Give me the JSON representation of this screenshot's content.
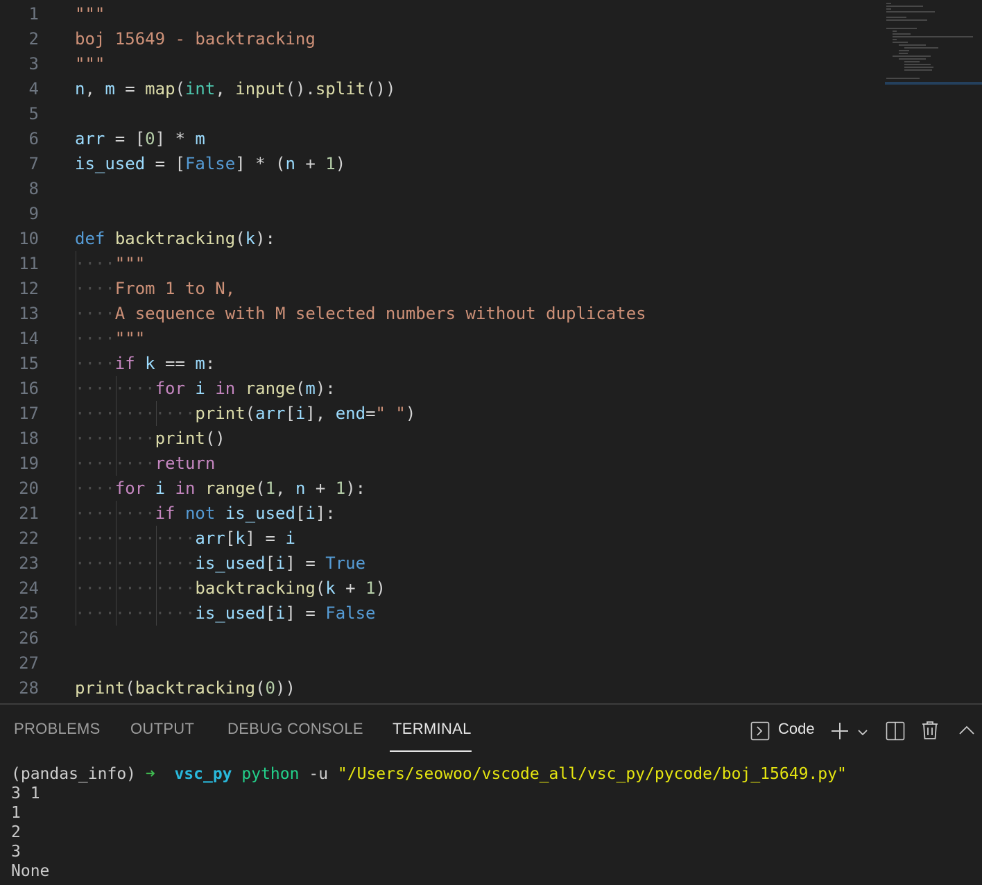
{
  "editor": {
    "lines": [
      {
        "n": "1",
        "tokens": [
          [
            "str",
            "\"\"\""
          ]
        ]
      },
      {
        "n": "2",
        "tokens": [
          [
            "str",
            "boj 15649 - backtracking"
          ]
        ]
      },
      {
        "n": "3",
        "tokens": [
          [
            "str",
            "\"\"\""
          ]
        ]
      },
      {
        "n": "4",
        "tokens": [
          [
            "var",
            "n"
          ],
          [
            "op",
            ", "
          ],
          [
            "var",
            "m"
          ],
          [
            "op",
            " = "
          ],
          [
            "fn",
            "map"
          ],
          [
            "op",
            "("
          ],
          [
            "type",
            "int"
          ],
          [
            "op",
            ", "
          ],
          [
            "fn",
            "input"
          ],
          [
            "op",
            "()."
          ],
          [
            "fn",
            "split"
          ],
          [
            "op",
            "())"
          ]
        ]
      },
      {
        "n": "5",
        "tokens": []
      },
      {
        "n": "6",
        "tokens": [
          [
            "var",
            "arr"
          ],
          [
            "op",
            " = ["
          ],
          [
            "num",
            "0"
          ],
          [
            "op",
            "] * "
          ],
          [
            "var",
            "m"
          ]
        ]
      },
      {
        "n": "7",
        "tokens": [
          [
            "var",
            "is_used"
          ],
          [
            "op",
            " = ["
          ],
          [
            "kw",
            "False"
          ],
          [
            "op",
            "] * ("
          ],
          [
            "var",
            "n"
          ],
          [
            "op",
            " + "
          ],
          [
            "num",
            "1"
          ],
          [
            "op",
            ")"
          ]
        ]
      },
      {
        "n": "8",
        "tokens": []
      },
      {
        "n": "9",
        "tokens": []
      },
      {
        "n": "10",
        "tokens": [
          [
            "kw",
            "def"
          ],
          [
            "op",
            " "
          ],
          [
            "fn",
            "backtracking"
          ],
          [
            "op",
            "("
          ],
          [
            "var",
            "k"
          ],
          [
            "op",
            "):"
          ]
        ]
      },
      {
        "n": "11",
        "tokens": [
          [
            "ws",
            "····"
          ],
          [
            "str",
            "\"\"\""
          ]
        ]
      },
      {
        "n": "12",
        "tokens": [
          [
            "ws",
            "····"
          ],
          [
            "str",
            "From 1 to N,"
          ]
        ]
      },
      {
        "n": "13",
        "tokens": [
          [
            "ws",
            "····"
          ],
          [
            "str",
            "A sequence with M selected numbers without duplicates"
          ]
        ]
      },
      {
        "n": "14",
        "tokens": [
          [
            "ws",
            "····"
          ],
          [
            "str",
            "\"\"\""
          ]
        ]
      },
      {
        "n": "15",
        "tokens": [
          [
            "ws",
            "····"
          ],
          [
            "ctl",
            "if"
          ],
          [
            "op",
            " "
          ],
          [
            "var",
            "k"
          ],
          [
            "op",
            " == "
          ],
          [
            "var",
            "m"
          ],
          [
            "op",
            ":"
          ]
        ]
      },
      {
        "n": "16",
        "tokens": [
          [
            "ws",
            "········"
          ],
          [
            "ctl",
            "for"
          ],
          [
            "op",
            " "
          ],
          [
            "var",
            "i"
          ],
          [
            "op",
            " "
          ],
          [
            "ctl",
            "in"
          ],
          [
            "op",
            " "
          ],
          [
            "fn",
            "range"
          ],
          [
            "op",
            "("
          ],
          [
            "var",
            "m"
          ],
          [
            "op",
            "):"
          ]
        ]
      },
      {
        "n": "17",
        "tokens": [
          [
            "ws",
            "············"
          ],
          [
            "fn",
            "print"
          ],
          [
            "op",
            "("
          ],
          [
            "var",
            "arr"
          ],
          [
            "op",
            "["
          ],
          [
            "var",
            "i"
          ],
          [
            "op",
            "], "
          ],
          [
            "var",
            "end"
          ],
          [
            "op",
            "="
          ],
          [
            "str",
            "\" \""
          ],
          [
            "op",
            ")"
          ]
        ]
      },
      {
        "n": "18",
        "tokens": [
          [
            "ws",
            "········"
          ],
          [
            "fn",
            "print"
          ],
          [
            "op",
            "()"
          ]
        ]
      },
      {
        "n": "19",
        "tokens": [
          [
            "ws",
            "········"
          ],
          [
            "ctl",
            "return"
          ]
        ]
      },
      {
        "n": "20",
        "tokens": [
          [
            "ws",
            "····"
          ],
          [
            "ctl",
            "for"
          ],
          [
            "op",
            " "
          ],
          [
            "var",
            "i"
          ],
          [
            "op",
            " "
          ],
          [
            "ctl",
            "in"
          ],
          [
            "op",
            " "
          ],
          [
            "fn",
            "range"
          ],
          [
            "op",
            "("
          ],
          [
            "num",
            "1"
          ],
          [
            "op",
            ", "
          ],
          [
            "var",
            "n"
          ],
          [
            "op",
            " + "
          ],
          [
            "num",
            "1"
          ],
          [
            "op",
            "):"
          ]
        ]
      },
      {
        "n": "21",
        "tokens": [
          [
            "ws",
            "········"
          ],
          [
            "ctl",
            "if"
          ],
          [
            "op",
            " "
          ],
          [
            "kw",
            "not"
          ],
          [
            "op",
            " "
          ],
          [
            "var",
            "is_used"
          ],
          [
            "op",
            "["
          ],
          [
            "var",
            "i"
          ],
          [
            "op",
            "]:"
          ]
        ]
      },
      {
        "n": "22",
        "tokens": [
          [
            "ws",
            "············"
          ],
          [
            "var",
            "arr"
          ],
          [
            "op",
            "["
          ],
          [
            "var",
            "k"
          ],
          [
            "op",
            "] = "
          ],
          [
            "var",
            "i"
          ]
        ]
      },
      {
        "n": "23",
        "tokens": [
          [
            "ws",
            "············"
          ],
          [
            "var",
            "is_used"
          ],
          [
            "op",
            "["
          ],
          [
            "var",
            "i"
          ],
          [
            "op",
            "] = "
          ],
          [
            "kw",
            "True"
          ]
        ]
      },
      {
        "n": "24",
        "tokens": [
          [
            "ws",
            "············"
          ],
          [
            "fn",
            "backtracking"
          ],
          [
            "op",
            "("
          ],
          [
            "var",
            "k"
          ],
          [
            "op",
            " + "
          ],
          [
            "num",
            "1"
          ],
          [
            "op",
            ")"
          ]
        ]
      },
      {
        "n": "25",
        "tokens": [
          [
            "ws",
            "············"
          ],
          [
            "var",
            "is_used"
          ],
          [
            "op",
            "["
          ],
          [
            "var",
            "i"
          ],
          [
            "op",
            "] = "
          ],
          [
            "kw",
            "False"
          ]
        ]
      },
      {
        "n": "26",
        "tokens": []
      },
      {
        "n": "27",
        "tokens": []
      },
      {
        "n": "28",
        "tokens": [
          [
            "fn",
            "print"
          ],
          [
            "op",
            "("
          ],
          [
            "fn",
            "backtracking"
          ],
          [
            "op",
            "("
          ],
          [
            "num",
            "0"
          ],
          [
            "op",
            "))"
          ]
        ]
      }
    ]
  },
  "panel": {
    "tabs": [
      "PROBLEMS",
      "OUTPUT",
      "DEBUG CONSOLE",
      "TERMINAL"
    ],
    "active_tab": "TERMINAL",
    "terminal_name": "Code",
    "icons": [
      "terminal-icon",
      "plus-icon",
      "chevron-down-icon",
      "split-icon",
      "trash-icon",
      "chevron-up-icon"
    ]
  },
  "terminal": {
    "prompt_env": "(pandas_info)",
    "prompt_arrow": "➜",
    "prompt_dir": "vsc_py",
    "cmd": "python",
    "flag": "-u",
    "path": "\"/Users/seowoo/vscode_all/vsc_py/pycode/boj_15649.py\"",
    "output": [
      "3 1",
      "1",
      "2",
      "3",
      "None"
    ]
  },
  "colors": {
    "background": "#1f1f1f",
    "string": "#ce9178",
    "keyword": "#569cd6",
    "control": "#c586c0",
    "function": "#dcdcaa",
    "variable": "#9cdcfe",
    "type": "#4ec9b0",
    "number": "#b5cea8"
  }
}
